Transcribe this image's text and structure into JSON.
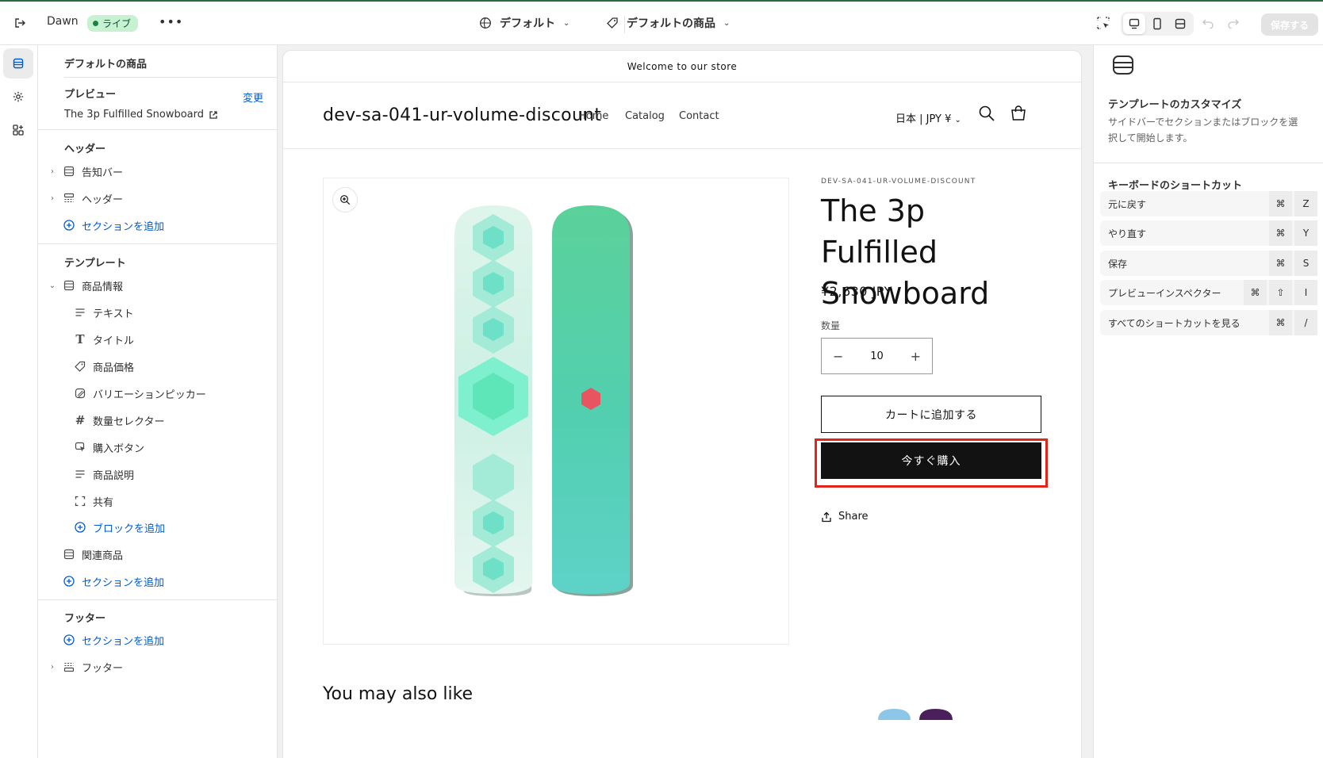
{
  "topbar": {
    "theme_name": "Dawn",
    "live_badge": "ライブ",
    "more": "•••",
    "layout_picker": "デフォルト",
    "template_picker": "デフォルトの商品",
    "save_label": "保存する"
  },
  "sidebar": {
    "title": "デフォルトの商品",
    "preview_heading": "プレビュー",
    "change_link": "変更",
    "preview_product": "The 3p Fulfilled Snowboard",
    "header_group": "ヘッダー",
    "announcement_bar": "告知バー",
    "header": "ヘッダー",
    "add_section": "セクションを追加",
    "template_group": "テンプレート",
    "product_info": "商品情報",
    "blocks": [
      {
        "label": "テキスト",
        "icon": "text-lines-icon"
      },
      {
        "label": "タイトル",
        "icon": "title-t-icon"
      },
      {
        "label": "商品価格",
        "icon": "price-tag-icon"
      },
      {
        "label": "バリエーションピッカー",
        "icon": "variant-picker-icon"
      },
      {
        "label": "数量セレクター",
        "icon": "hash-icon"
      },
      {
        "label": "購入ボタン",
        "icon": "buy-cursor-icon"
      },
      {
        "label": "商品説明",
        "icon": "text-lines-icon"
      },
      {
        "label": "共有",
        "icon": "share-frame-icon"
      }
    ],
    "add_block": "ブロックを追加",
    "related_products": "関連商品",
    "footer_group": "フッター",
    "footer": "フッター"
  },
  "preview": {
    "announcement": "Welcome to our store",
    "shop_name": "dev-sa-041-ur-volume-discount",
    "nav": [
      "Home",
      "Catalog",
      "Contact"
    ],
    "locale": "日本 | JPY ¥",
    "vendor": "DEV-SA-041-UR-VOLUME-DISCOUNT",
    "product_title": "The 3p Fulfilled Snowboard",
    "price": "¥2,630 JPY",
    "quantity_label": "数量",
    "quantity_value": "10",
    "qty_minus": "−",
    "qty_plus": "+",
    "add_to_cart": "カートに追加する",
    "buy_now": "今すぐ購入",
    "share": "Share",
    "also_like": "You may also like"
  },
  "rpanel": {
    "title": "テンプレートのカスタマイズ",
    "description": "サイドバーでセクションまたはブロックを選択して開始します。",
    "shortcuts_title": "キーボードのショートカット",
    "shortcuts": [
      {
        "label": "元に戻す",
        "keys": [
          "⌘",
          "Z"
        ]
      },
      {
        "label": "やり直す",
        "keys": [
          "⌘",
          "Y"
        ]
      },
      {
        "label": "保存",
        "keys": [
          "⌘",
          "S"
        ]
      },
      {
        "label": "プレビューインスペクター",
        "keys": [
          "⌘",
          "⇧",
          "I"
        ]
      },
      {
        "label": "すべてのショートカットを見る",
        "keys": [
          "⌘",
          "/"
        ]
      }
    ]
  },
  "colors": {
    "accent_link": "#005bd3",
    "live_badge_bg": "#c6f2d2",
    "buy_button_bg": "#121212",
    "highlight_border": "#e0251b"
  }
}
